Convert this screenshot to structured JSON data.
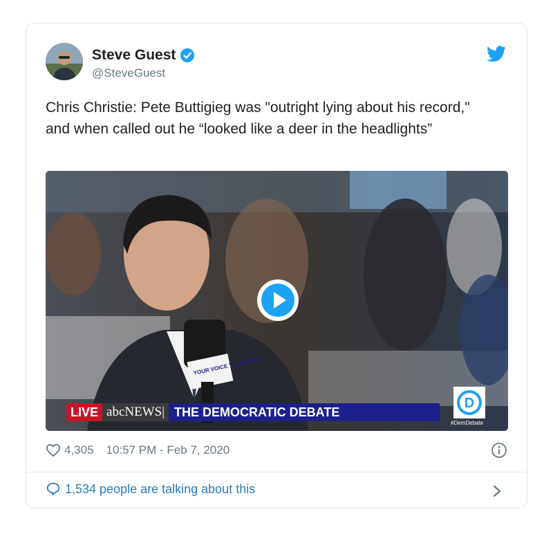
{
  "tweet": {
    "author_name": "Steve Guest",
    "author_handle": "@SteveGuest",
    "text": "Chris Christie: Pete Buttigieg was \"outright lying about his record,\" and when called out he “looked like a deer in the headlights”",
    "likes": "4,305",
    "timestamp": "10:57 PM - Feb 7, 2020",
    "talking": "1,534 people are talking about this"
  },
  "video": {
    "live_label": "LIVE",
    "network_label": "abcNEWS|",
    "chyron": "THE DEMOCRATIC DEBATE",
    "dnc_letter": "D",
    "dnc_tag": "#DemDebate",
    "mic_flag_text": "YOUR VOICE YOUR VOTE"
  },
  "icons": {
    "verified": "verified-badge-icon",
    "bird": "twitter-bird-icon",
    "play": "play-icon",
    "heart": "heart-icon",
    "info": "info-icon",
    "bubble": "speech-bubble-icon",
    "chevron": "chevron-right-icon"
  },
  "colors": {
    "brand_blue": "#1da1f2",
    "link_blue": "#2b7bb9",
    "muted": "#697882",
    "live_red": "#c9152a",
    "chyron_blue": "#1d1f8a"
  }
}
